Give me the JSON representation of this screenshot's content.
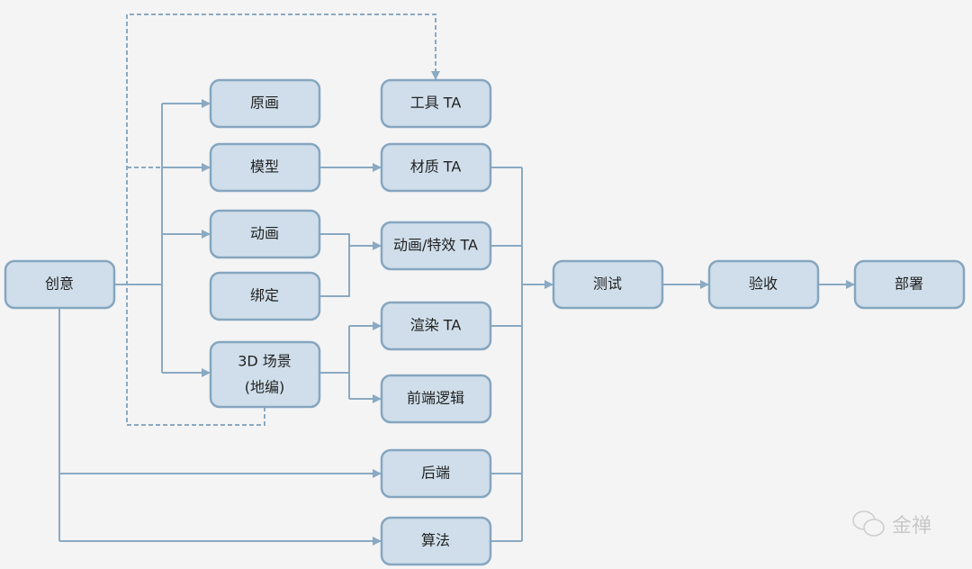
{
  "nodes": {
    "idea": "创意",
    "concept_art": "原画",
    "model": "模型",
    "animation": "动画",
    "rigging": "绑定",
    "scene_line1": "3D 场景",
    "scene_line2": "(地编)",
    "tool_ta": "工具 TA",
    "material_ta": "材质 TA",
    "anim_fx_ta": "动画/特效 TA",
    "render_ta": "渲染 TA",
    "frontend_logic": "前端逻辑",
    "backend": "后端",
    "algorithm": "算法",
    "test": "测试",
    "acceptance": "验收",
    "deploy": "部署"
  },
  "watermark": {
    "icon": "wechat-icon",
    "text": "金禅"
  },
  "colors": {
    "node_fill": "#cfdeea",
    "node_stroke": "#86a6bf",
    "line": "#8aa9c2",
    "background": "#f4f4f5"
  }
}
